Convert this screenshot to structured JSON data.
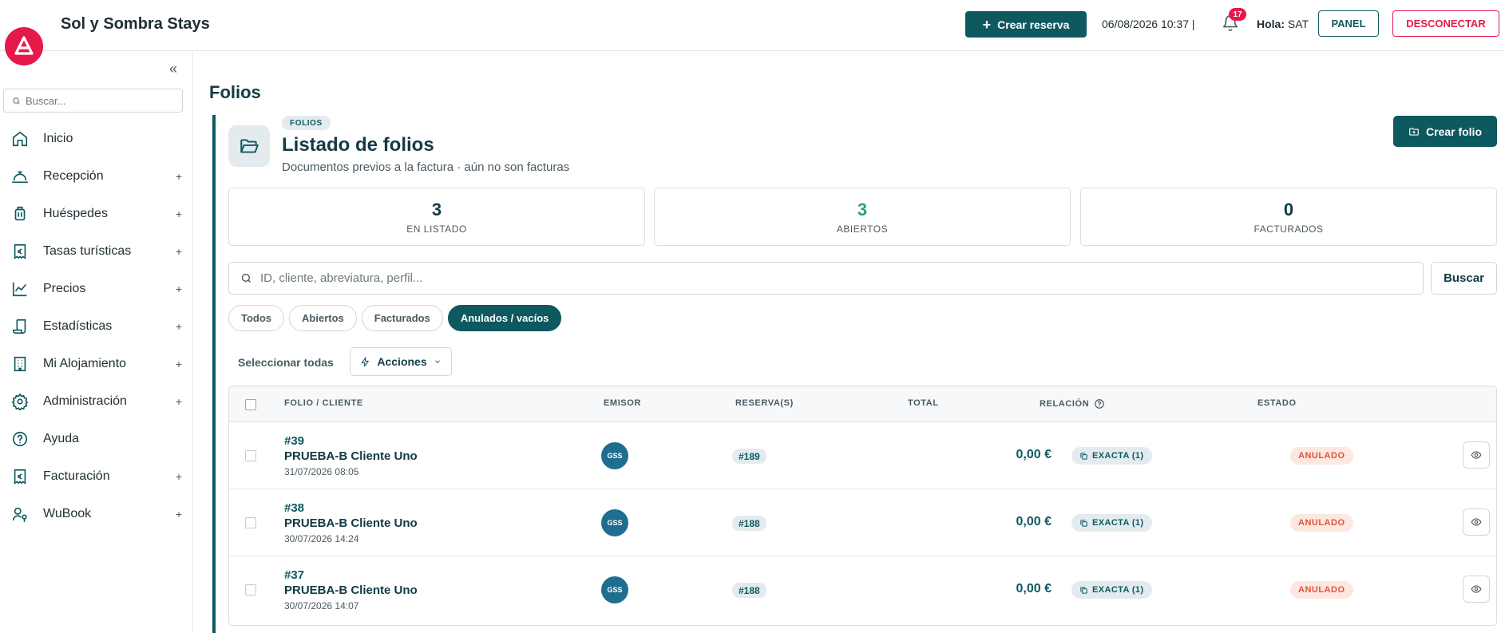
{
  "header": {
    "app_title": "Sol y Sombra Stays",
    "create_reservation": "Crear reserva",
    "datetime": "06/08/2026 10:37 |",
    "notifications_count": "17",
    "greeting_label": "Hola:",
    "user": "SAT",
    "panel": "PANEL",
    "logout": "DESCONECTAR"
  },
  "sidebar": {
    "search_placeholder": "Buscar...",
    "items": [
      {
        "label": "Inicio",
        "icon": "home-icon",
        "expandable": false
      },
      {
        "label": "Recepción",
        "icon": "bell-desk-icon",
        "expandable": true
      },
      {
        "label": "Huéspedes",
        "icon": "luggage-icon",
        "expandable": true
      },
      {
        "label": "Tasas turísticas",
        "icon": "euro-receipt-icon",
        "expandable": true
      },
      {
        "label": "Precios",
        "icon": "line-chart-icon",
        "expandable": true
      },
      {
        "label": "Estadísticas",
        "icon": "scroll-icon",
        "expandable": true
      },
      {
        "label": "Mi Alojamiento",
        "icon": "building-icon",
        "expandable": true
      },
      {
        "label": "Administración",
        "icon": "gear-icon",
        "expandable": true
      },
      {
        "label": "Ayuda",
        "icon": "help-circle-icon",
        "expandable": false
      },
      {
        "label": "Facturación",
        "icon": "euro-receipt-icon",
        "expandable": true
      },
      {
        "label": "WuBook",
        "icon": "user-key-icon",
        "expandable": true
      }
    ]
  },
  "main": {
    "page_title": "Folios",
    "section_tag": "FOLIOS",
    "list_title": "Listado de folios",
    "list_subtitle": "Documentos previos a la factura · aún no son facturas",
    "create_folio": "Crear folio",
    "stats": [
      {
        "value": "3",
        "label": "EN LISTADO"
      },
      {
        "value": "3",
        "label": "ABIERTOS"
      },
      {
        "value": "0",
        "label": "FACTURADOS"
      }
    ],
    "search_placeholder": "ID, cliente, abreviatura, perfil...",
    "search_button": "Buscar",
    "filters": [
      "Todos",
      "Abiertos",
      "Facturados",
      "Anulados / vacíos"
    ],
    "active_filter": "Anulados / vacíos",
    "select_all": "Seleccionar todas",
    "actions": "Acciones",
    "columns": [
      "FOLIO / CLIENTE",
      "EMISOR",
      "RESERVA(S)",
      "TOTAL",
      "RELACIÓN",
      "ESTADO"
    ],
    "rows": [
      {
        "id": "#39",
        "client": "PRUEBA-B Cliente Uno",
        "date": "31/07/2026 08:05",
        "emisor": "GSS",
        "reserva": "#189",
        "total": "0,00 €",
        "relacion": "EXACTA (1)",
        "estado": "ANULADO"
      },
      {
        "id": "#38",
        "client": "PRUEBA-B Cliente Uno",
        "date": "30/07/2026 14:24",
        "emisor": "GSS",
        "reserva": "#188",
        "total": "0,00 €",
        "relacion": "EXACTA (1)",
        "estado": "ANULADO"
      },
      {
        "id": "#37",
        "client": "PRUEBA-B Cliente Uno",
        "date": "30/07/2026 14:07",
        "emisor": "GSS",
        "reserva": "#188",
        "total": "0,00 €",
        "relacion": "EXACTA (1)",
        "estado": "ANULADO"
      }
    ]
  },
  "colors": {
    "brand_teal": "#0e5960",
    "brand_red": "#e5194a",
    "stat_green": "#2aa37f",
    "status_red": "#e1533a"
  }
}
